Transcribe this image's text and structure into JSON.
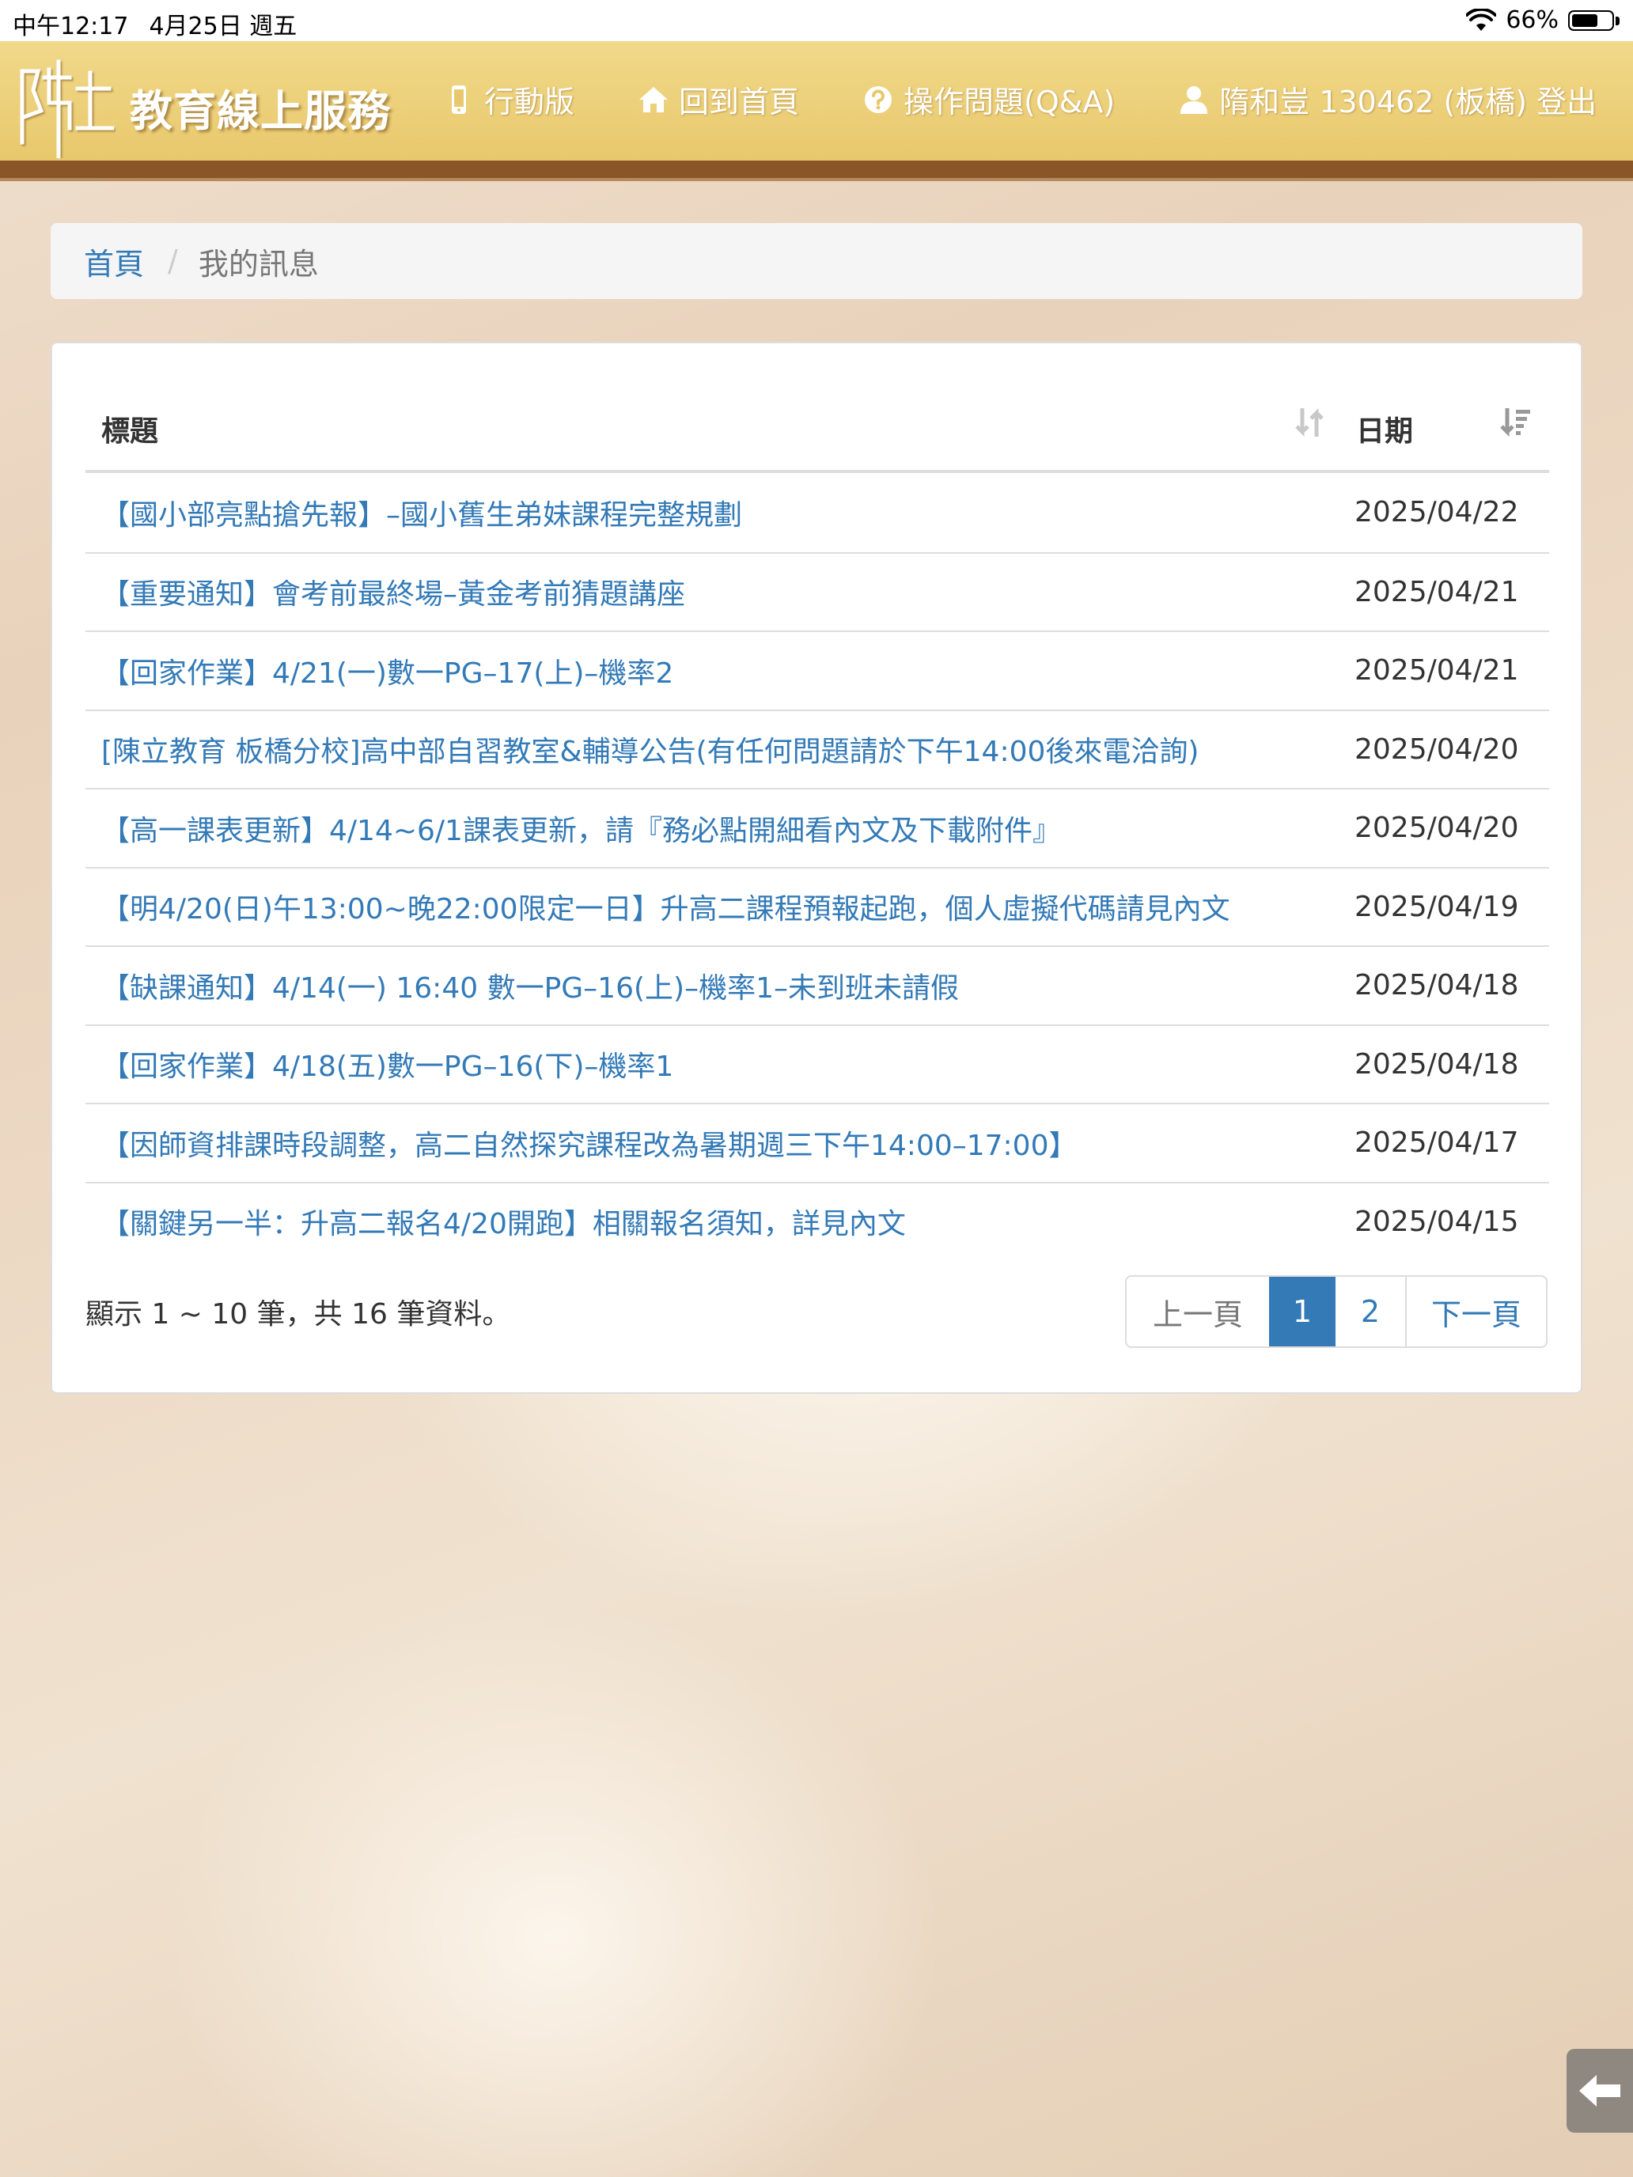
{
  "status_bar": {
    "time": "中午12:17",
    "date": "4月25日 週五",
    "battery": "66%",
    "battery_level": 0.66
  },
  "navbar": {
    "brand": "教育線上服務",
    "links": [
      {
        "label": "行動版",
        "icon": "mobile-icon"
      },
      {
        "label": "回到首頁",
        "icon": "home-icon"
      },
      {
        "label": "操作問題(Q&A)",
        "icon": "question-circle-icon"
      },
      {
        "label": "隋和豈 130462 (板橋) 登出",
        "icon": "user-icon"
      }
    ]
  },
  "breadcrumb": {
    "home": "首頁",
    "separator": "/",
    "current": "我的訊息"
  },
  "table": {
    "headers": {
      "title": "標題",
      "date": "日期"
    },
    "rows": [
      {
        "title": "【國小部亮點搶先報】–國小舊生弟妹課程完整規劃",
        "date": "2025/04/22"
      },
      {
        "title": "【重要通知】會考前最終場–黃金考前猜題講座",
        "date": "2025/04/21"
      },
      {
        "title": "【回家作業】4/21(一)數一PG–17(上)–機率2",
        "date": "2025/04/21"
      },
      {
        "title": "[陳立教育 板橋分校]高中部自習教室&輔導公告(有任何問題請於下午14:00後來電洽詢)",
        "date": "2025/04/20"
      },
      {
        "title": "【高一課表更新】4/14~6/1課表更新，請『務必點開細看內文及下載附件』",
        "date": "2025/04/20"
      },
      {
        "title": "【明4/20(日)午13:00~晚22:00限定一日】升高二課程預報起跑，個人虛擬代碼請見內文",
        "date": "2025/04/19"
      },
      {
        "title": "【缺課通知】4/14(一) 16:40 數一PG–16(上)–機率1–未到班未請假",
        "date": "2025/04/18"
      },
      {
        "title": "【回家作業】4/18(五)數一PG–16(下)–機率1",
        "date": "2025/04/18"
      },
      {
        "title": "【因師資排課時段調整，高二自然探究課程改為暑期週三下午14:00–17:00】",
        "date": "2025/04/17"
      },
      {
        "title": "【關鍵另一半：升高二報名4/20開跑】相關報名須知，詳見內文",
        "date": "2025/04/15"
      }
    ]
  },
  "summary": "顯示 1 ~ 10 筆，共 16 筆資料。",
  "pagination": {
    "prev": "上一頁",
    "pages": [
      "1",
      "2"
    ],
    "active": "1",
    "next": "下一頁"
  },
  "colors": {
    "link": "#337ab7",
    "navbar": "#e8c86c",
    "navbar_border": "#8a5527",
    "active_page": "#337ab7"
  }
}
